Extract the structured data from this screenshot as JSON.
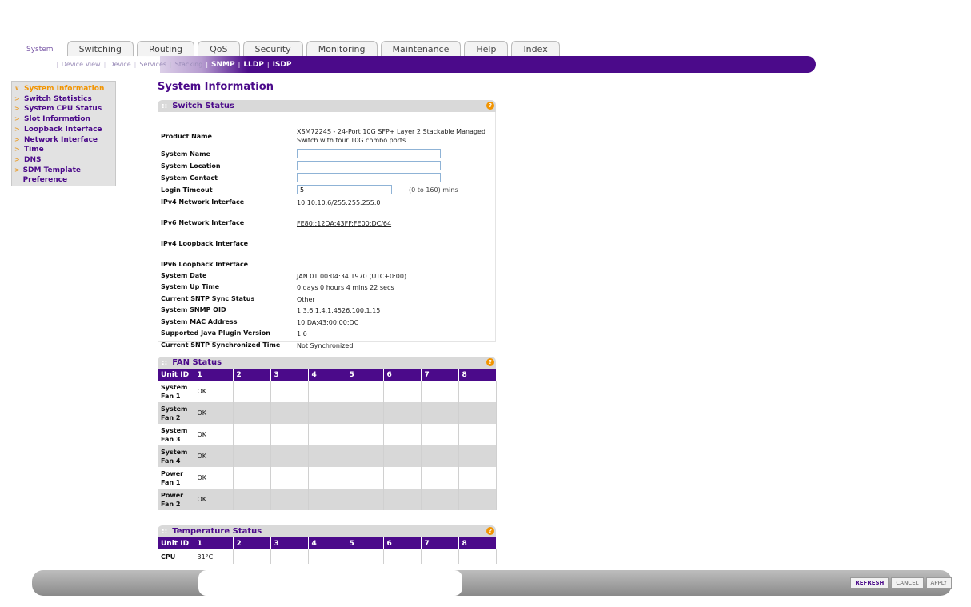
{
  "tabs": [
    {
      "label": "System",
      "active": true
    },
    {
      "label": "Switching"
    },
    {
      "label": "Routing"
    },
    {
      "label": "QoS"
    },
    {
      "label": "Security"
    },
    {
      "label": "Monitoring"
    },
    {
      "label": "Maintenance"
    },
    {
      "label": "Help"
    },
    {
      "label": "Index"
    }
  ],
  "subnav": [
    {
      "label": "Device View"
    },
    {
      "label": "Device"
    },
    {
      "label": "Services"
    },
    {
      "label": "Stacking"
    },
    {
      "label": "SNMP",
      "on": true
    },
    {
      "label": "LLDP",
      "on": true
    },
    {
      "label": "ISDP",
      "on": true
    }
  ],
  "leftmenu": [
    {
      "label": "System Information",
      "active": true
    },
    {
      "label": "Switch Statistics"
    },
    {
      "label": "System CPU Status"
    },
    {
      "label": "Slot Information"
    },
    {
      "label": "Loopback Interface"
    },
    {
      "label": "Network Interface"
    },
    {
      "label": "Time"
    },
    {
      "label": "DNS"
    },
    {
      "label": "SDM Template Preference"
    }
  ],
  "page_title": "System Information",
  "switch_status": {
    "title": "Switch Status",
    "product_name_label": "Product Name",
    "product_name": "XSM7224S - 24-Port 10G SFP+ Layer 2 Stackable Managed Switch with four 10G combo ports",
    "system_name_label": "System Name",
    "system_name": "",
    "system_location_label": "System Location",
    "system_location": "",
    "system_contact_label": "System Contact",
    "system_contact": "",
    "login_timeout_label": "Login Timeout",
    "login_timeout": "5",
    "login_timeout_hint": "(0 to 160) mins",
    "ipv4_if_label": "IPv4 Network Interface",
    "ipv4_if": "10.10.10.6/255.255.255.0",
    "ipv6_if_label": "IPv6 Network Interface",
    "ipv6_if": "FE80::12DA:43FF:FE00:DC/64",
    "ipv4_lb_label": "IPv4 Loopback Interface",
    "ipv6_lb_label": "IPv6 Loopback Interface",
    "system_date_label": "System Date",
    "system_date": "JAN 01 00:04:34 1970 (UTC+0:00)",
    "uptime_label": "System Up Time",
    "uptime": "0 days 0 hours 4 mins 22 secs",
    "sntp_status_label": "Current SNTP Sync Status",
    "sntp_status": "Other",
    "snmp_oid_label": "System SNMP OID",
    "snmp_oid": "1.3.6.1.4.1.4526.100.1.15",
    "mac_label": "System MAC Address",
    "mac": "10:DA:43:00:00:DC",
    "java_label": "Supported Java Plugin Version",
    "java": "1.6",
    "sntp_time_label": "Current SNTP Synchronized Time",
    "sntp_time": "Not Synchronized"
  },
  "fan_status": {
    "title": "FAN Status",
    "headers": [
      "Unit ID",
      "1",
      "2",
      "3",
      "4",
      "5",
      "6",
      "7",
      "8"
    ],
    "rows": [
      {
        "name": "System Fan 1",
        "cells": [
          "OK",
          "",
          "",
          "",
          "",
          "",
          "",
          ""
        ]
      },
      {
        "name": "System Fan 2",
        "cells": [
          "OK",
          "",
          "",
          "",
          "",
          "",
          "",
          ""
        ]
      },
      {
        "name": "System Fan 3",
        "cells": [
          "OK",
          "",
          "",
          "",
          "",
          "",
          "",
          ""
        ]
      },
      {
        "name": "System Fan 4",
        "cells": [
          "OK",
          "",
          "",
          "",
          "",
          "",
          "",
          ""
        ]
      },
      {
        "name": "Power Fan 1",
        "cells": [
          "OK",
          "",
          "",
          "",
          "",
          "",
          "",
          ""
        ]
      },
      {
        "name": "Power Fan 2",
        "cells": [
          "OK",
          "",
          "",
          "",
          "",
          "",
          "",
          ""
        ]
      }
    ]
  },
  "temperature_status": {
    "title": "Temperature Status",
    "headers": [
      "Unit ID",
      "1",
      "2",
      "3",
      "4",
      "5",
      "6",
      "7",
      "8"
    ],
    "rows": [
      {
        "name": "CPU",
        "cells": [
          "31°C",
          "",
          "",
          "",
          "",
          "",
          "",
          ""
        ]
      }
    ]
  },
  "buttons": {
    "refresh": "REFRESH",
    "cancel": "CANCEL",
    "apply": "APPLY"
  },
  "icons": {
    "help": "help-icon",
    "arrow": "arrow-icon"
  },
  "colors": {
    "brand_purple": "#4b0a8a",
    "accent_orange": "#f29400",
    "link_blue": "#1a3fae"
  }
}
